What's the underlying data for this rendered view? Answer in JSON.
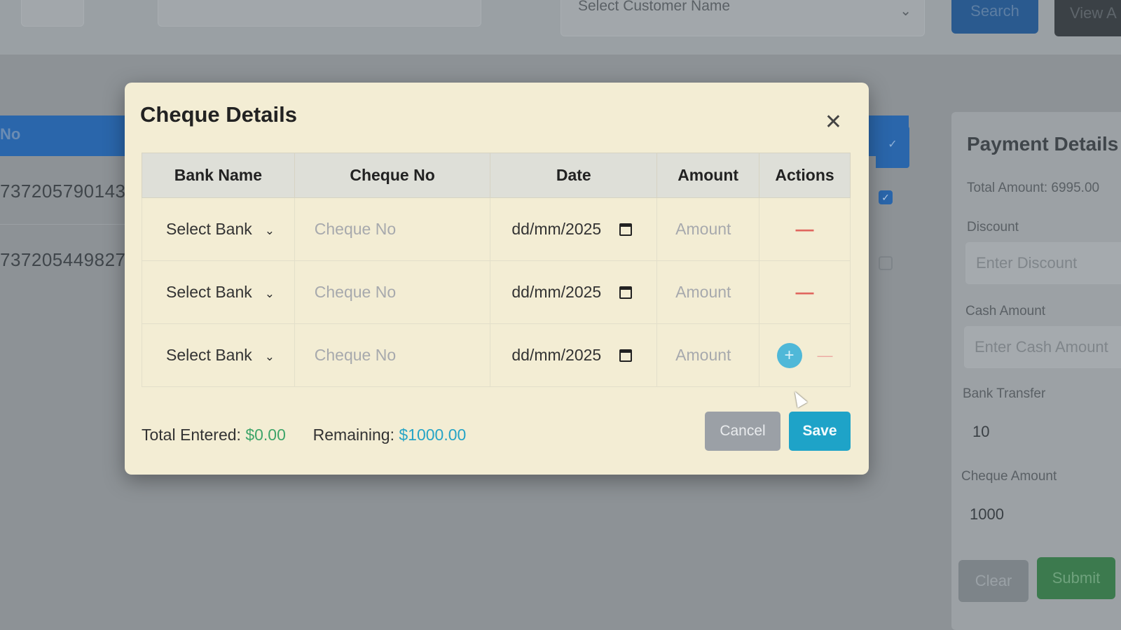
{
  "background": {
    "top_select": {
      "placeholder": "Select Customer Name"
    },
    "search_label": "Search",
    "view_label": "View A",
    "table": {
      "header_no": "No",
      "rows": [
        {
          "id": "737205790143"
        },
        {
          "id": "737205449827"
        }
      ]
    },
    "payment_panel": {
      "title": "Payment Details",
      "total_amount": "Total Amount: 6995.00",
      "discount_label": "Discount",
      "discount_placeholder": "Enter Discount",
      "cash_label": "Cash Amount",
      "cash_placeholder": "Enter Cash Amount",
      "bank_label": "Bank Transfer",
      "bank_value": "10",
      "cheque_label": "Cheque Amount",
      "cheque_value": "1000",
      "clear_label": "Clear",
      "submit_label": "Submit"
    }
  },
  "modal": {
    "title": "Cheque Details",
    "columns": [
      "Bank Name",
      "Cheque No",
      "Date",
      "Amount",
      "Actions"
    ],
    "rows": [
      {
        "bank": "Select Bank",
        "cheque_placeholder": "Cheque No",
        "date": "dd/mm/2025",
        "amount_placeholder": "Amount"
      },
      {
        "bank": "Select Bank",
        "cheque_placeholder": "Cheque No",
        "date": "dd/mm/2025",
        "amount_placeholder": "Amount"
      },
      {
        "bank": "Select Bank",
        "cheque_placeholder": "Cheque No",
        "date": "dd/mm/2025",
        "amount_placeholder": "Amount"
      }
    ],
    "total_entered_label": "Total Entered:",
    "total_entered_value": "$0.00",
    "remaining_label": "Remaining:",
    "remaining_value": "$1000.00",
    "cancel_label": "Cancel",
    "save_label": "Save"
  },
  "icons": {
    "close": "close-icon",
    "chevron": "chevron-down-icon",
    "calendar": "calendar-icon",
    "minus": "minus-icon",
    "plus": "plus-icon"
  },
  "colors": {
    "modal_bg": "#f3edd4",
    "primary": "#2a66ab",
    "save": "#1ea3c8",
    "success": "#3ea56a",
    "danger": "#e0665e"
  }
}
